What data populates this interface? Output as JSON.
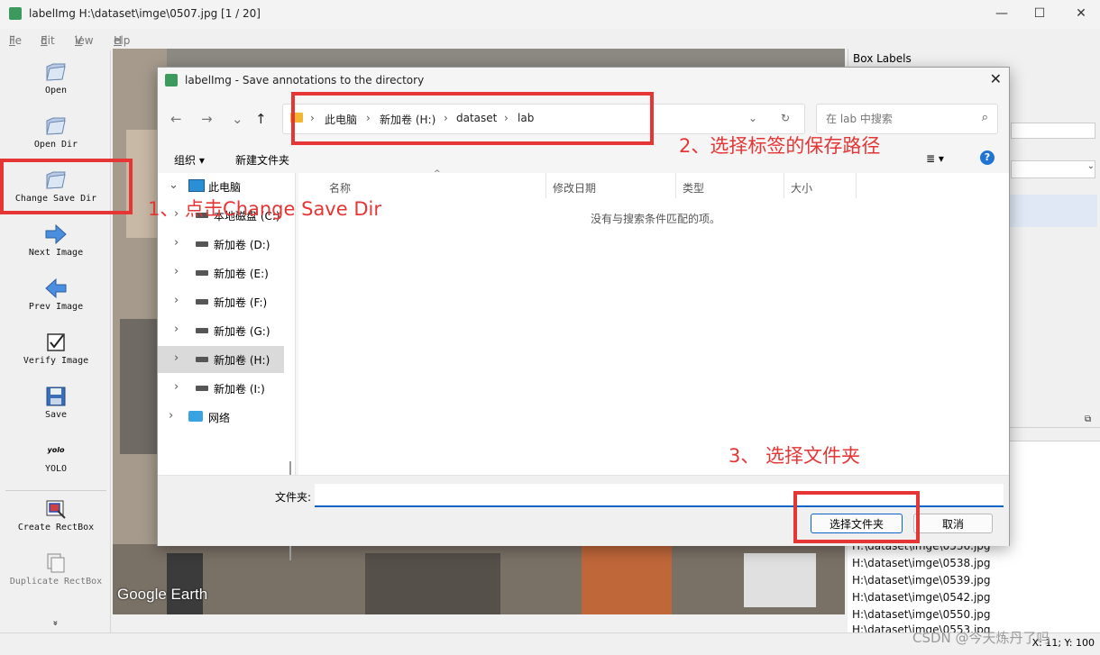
{
  "window": {
    "title": "labelImg H:\\dataset\\imge\\0507.jpg [1 / 20]",
    "controls": {
      "minimize": "—",
      "maximize": "☐",
      "close": "✕"
    }
  },
  "menu": {
    "file": "File",
    "edit": "Edit",
    "view": "View",
    "help": "Help"
  },
  "toolbar": {
    "items": [
      {
        "label": "Open",
        "icon": "folder-icon"
      },
      {
        "label": "Open Dir",
        "icon": "folder-icon"
      },
      {
        "label": "Change Save Dir",
        "icon": "folder-icon"
      },
      {
        "label": "Next Image",
        "icon": "arrow-right-icon"
      },
      {
        "label": "Prev Image",
        "icon": "arrow-left-icon"
      },
      {
        "label": "Verify Image",
        "icon": "checkbox-icon"
      },
      {
        "label": "Save",
        "icon": "floppy-icon"
      },
      {
        "label": "YOLO",
        "icon": "yolo-icon",
        "icon_text": "yolo"
      },
      {
        "label": "Create RectBox",
        "icon": "rectbox-icon"
      },
      {
        "label": "Duplicate RectBox",
        "icon": "duplicate-icon"
      }
    ],
    "more": "»"
  },
  "canvas": {
    "watermark": "Google Earth"
  },
  "right_panel": {
    "box_labels_title": "Box Labels",
    "file_list": [
      "H:\\dataset\\imge\\0536.jpg",
      "H:\\dataset\\imge\\0538.jpg",
      "H:\\dataset\\imge\\0539.jpg",
      "H:\\dataset\\imge\\0542.jpg",
      "H:\\dataset\\imge\\0550.jpg",
      "H:\\dataset\\imge\\0553.jpg"
    ]
  },
  "status": {
    "coords": "X: 11; Y: 100"
  },
  "watermark_csdn": "CSDN @今天炼丹了吗",
  "dialog": {
    "title": "labelImg - Save annotations to the directory",
    "close": "✕",
    "nav": {
      "back": "←",
      "forward": "→",
      "recent": "⌄",
      "up": "↑"
    },
    "breadcrumb": [
      "此电脑",
      "新加卷 (H:)",
      "dataset",
      "lab"
    ],
    "breadcrumb_sep": "›",
    "refresh": "↻",
    "dropdown": "⌄",
    "search_placeholder": "在 lab 中搜索",
    "command_bar": {
      "organize": "组织 ▾",
      "new_folder": "新建文件夹",
      "view": "≣ ▾",
      "help": "?"
    },
    "tree": [
      {
        "label": "此电脑",
        "arrow": "⌄",
        "type": "pc"
      },
      {
        "label": "本地磁盘 (C:)",
        "arrow": "›",
        "type": "drive"
      },
      {
        "label": "新加卷 (D:)",
        "arrow": "›",
        "type": "drive"
      },
      {
        "label": "新加卷 (E:)",
        "arrow": "›",
        "type": "drive"
      },
      {
        "label": "新加卷 (F:)",
        "arrow": "›",
        "type": "drive"
      },
      {
        "label": "新加卷 (G:)",
        "arrow": "›",
        "type": "drive"
      },
      {
        "label": "新加卷 (H:)",
        "arrow": "›",
        "type": "drive",
        "selected": true
      },
      {
        "label": "新加卷 (I:)",
        "arrow": "›",
        "type": "drive"
      },
      {
        "label": "网络",
        "arrow": "›",
        "type": "network"
      }
    ],
    "columns": [
      "名称",
      "修改日期",
      "类型",
      "大小"
    ],
    "empty_message": "没有与搜索条件匹配的项。",
    "folder_label": "文件夹:",
    "folder_value": "",
    "select_folder_button": "选择文件夹",
    "cancel_button": "取消"
  },
  "annotations": {
    "step1": "1、 点击Change Save Dir",
    "step2": "2、选择标签的保存路径",
    "step3": "3、 选择文件夹"
  },
  "colors": {
    "annotation_red": "#e53535",
    "accent_blue": "#0a64c8"
  }
}
